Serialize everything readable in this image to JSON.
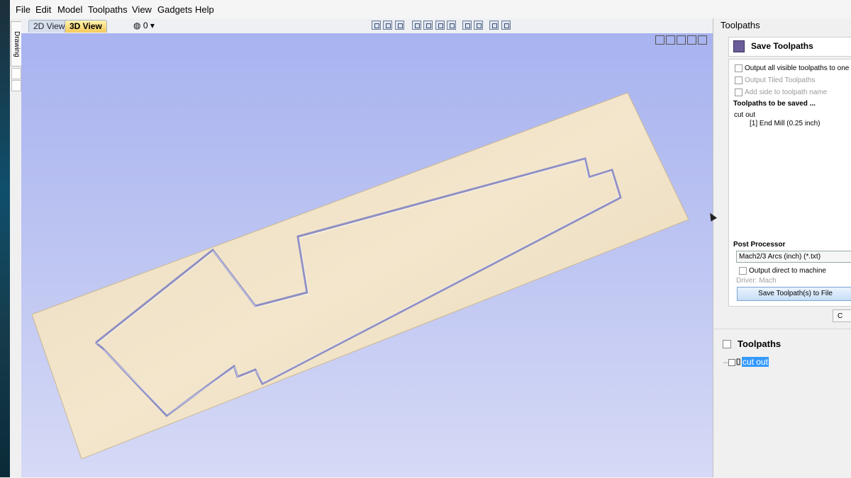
{
  "menu": [
    "File",
    "Edit",
    "Model",
    "Toolpaths",
    "View",
    "Gadgets",
    "Help"
  ],
  "drawing_tab": {
    "label": "Drawing"
  },
  "view_tabs": {
    "tab_2d": "2D View",
    "tab_3d": "3D View",
    "layer_indicator": "0"
  },
  "panel": {
    "title": "Toolpaths",
    "section_title": "Save Toolpaths",
    "output_all_label": "Output all visible toolpaths to one file",
    "output_tiled_label": "Output Tiled Toolpaths",
    "add_side_label": "Add side to toolpath name",
    "to_be_saved_heading": "Toolpaths to be saved ...",
    "saved_item_name": "cut out",
    "saved_item_tool": "[1] End Mill (0.25 inch)",
    "post_processor_heading": "Post Processor",
    "post_processor_value": "Mach2/3 Arcs (inch) (*.txt)",
    "output_direct_label": "Output direct to machine",
    "driver_label": "Driver: Mach",
    "save_button_label": "Save Toolpath(s) to File",
    "close_button_label": "C"
  },
  "toolpath_list": {
    "title": "Toolpaths",
    "items": [
      {
        "name": "cut out"
      }
    ]
  }
}
